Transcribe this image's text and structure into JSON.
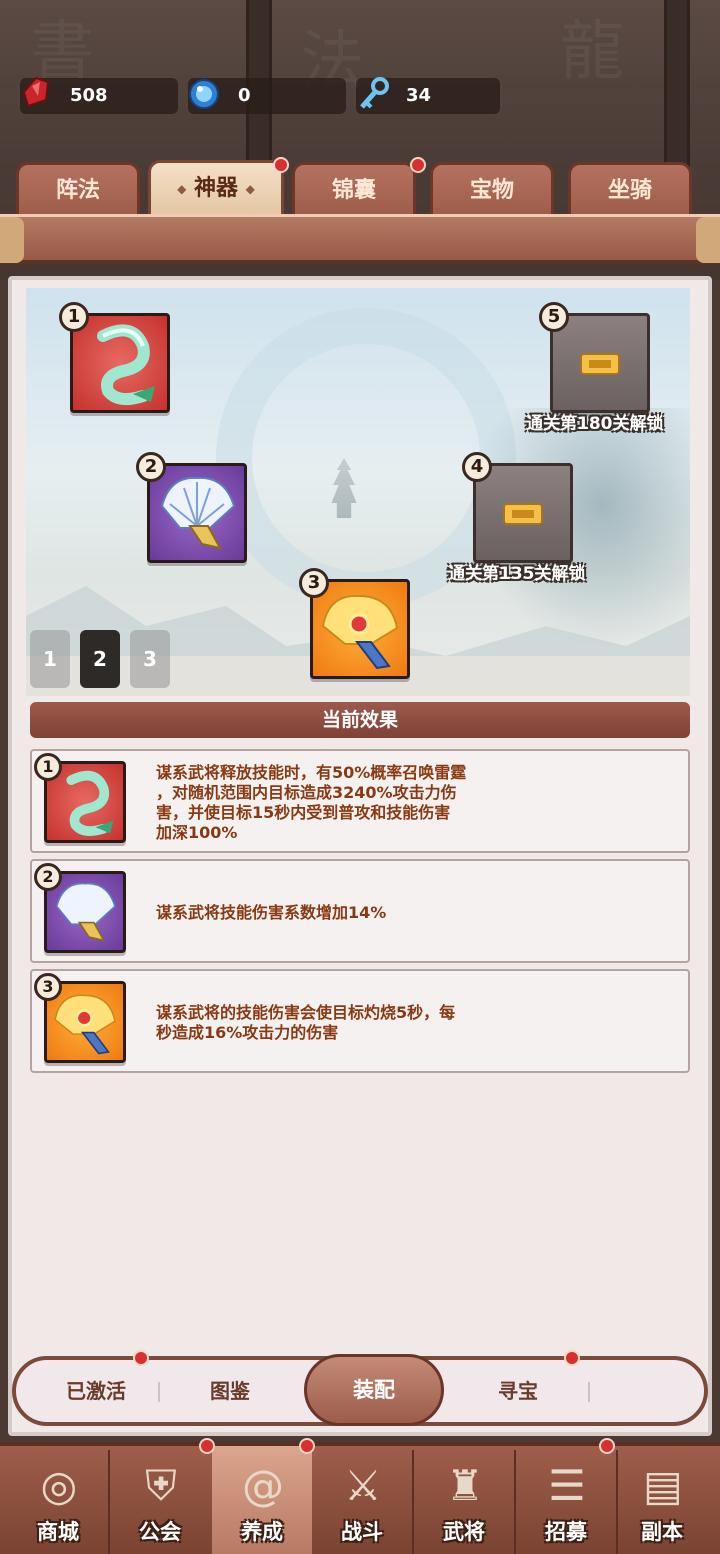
{
  "currencies": [
    {
      "icon": "red-gem-icon",
      "value": "508"
    },
    {
      "icon": "blue-orb-icon",
      "value": "0"
    },
    {
      "icon": "key-icon",
      "value": "34"
    }
  ],
  "tabs": [
    {
      "label": "阵法",
      "active": false,
      "dot": false
    },
    {
      "label": "神器",
      "active": true,
      "dot": true
    },
    {
      "label": "锦囊",
      "active": false,
      "dot": true
    },
    {
      "label": "宝物",
      "active": false,
      "dot": false
    },
    {
      "label": "坐骑",
      "active": false,
      "dot": false
    }
  ],
  "slots": [
    {
      "num": "1",
      "rarity": "red",
      "icon": "jade-dragon-icon"
    },
    {
      "num": "2",
      "rarity": "purple",
      "icon": "feather-fan-icon"
    },
    {
      "num": "3",
      "rarity": "orange",
      "icon": "golden-fan-icon"
    },
    {
      "num": "4",
      "rarity": "locked",
      "icon": "locked-slot-icon",
      "caption": "通关第135关解锁"
    },
    {
      "num": "5",
      "rarity": "locked",
      "icon": "locked-slot-icon",
      "caption": "通关第180关解锁"
    }
  ],
  "pages": [
    "1",
    "2",
    "3"
  ],
  "effects_title": "当前效果",
  "effects": [
    {
      "num": "1",
      "rarity": "red",
      "icon": "jade-dragon-icon",
      "lines": [
        "谋系武将释放技能时，有50%概率召唤雷霆",
        "，对随机范围内目标造成3240%攻击力伤",
        "害，并使目标15秒内受到普攻和技能伤害",
        "加深100%"
      ]
    },
    {
      "num": "2",
      "rarity": "purple",
      "icon": "feather-fan-icon",
      "lines": [
        "谋系武将技能伤害系数增加14%"
      ]
    },
    {
      "num": "3",
      "rarity": "orange",
      "icon": "golden-fan-icon",
      "lines": [
        "谋系武将的技能伤害会使目标灼烧5秒，每",
        "秒造成16%攻击力的伤害"
      ]
    }
  ],
  "subnav": {
    "activated": "已激活",
    "catalog": "图鉴",
    "equip": "装配",
    "treasure": "寻宝"
  },
  "bottom_nav": [
    {
      "label": "商城",
      "icon": "coin-shop-icon"
    },
    {
      "label": "公会",
      "icon": "shield-swords-icon"
    },
    {
      "label": "养成",
      "icon": "swirl-icon"
    },
    {
      "label": "战斗",
      "icon": "crossed-swords-icon"
    },
    {
      "label": "武将",
      "icon": "helmet-icon"
    },
    {
      "label": "招募",
      "icon": "scroll-icon"
    },
    {
      "label": "副本",
      "icon": "map-icon"
    }
  ]
}
